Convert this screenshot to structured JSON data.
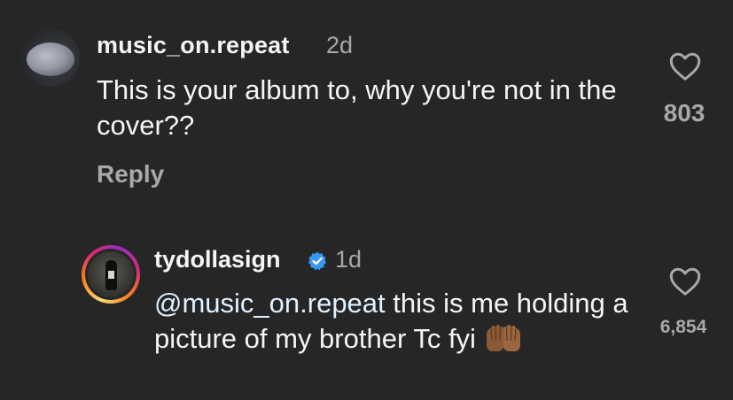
{
  "comments": [
    {
      "username": "music_on.repeat",
      "time": "2d",
      "text": "This is your album to, why you're not in the cover??",
      "reply_label": "Reply",
      "likes": "803",
      "avatar_icon": "avatar-photo",
      "like_icon": "heart-outline-icon"
    },
    {
      "username": "tydollasign",
      "verified": true,
      "time": "1d",
      "mention": "@music_on.repeat",
      "text": " this is me holding a picture of my brother Tc fyi ",
      "emoji": "palms-up-together-icon",
      "likes": "6,854",
      "avatar_icon": "avatar-photo-story-ring",
      "like_icon": "heart-outline-icon"
    }
  ],
  "colors": {
    "background": "#262626",
    "primary_text": "#f5f5f5",
    "secondary_text": "#a8a8a8",
    "verified_badge": "#3897f0"
  }
}
